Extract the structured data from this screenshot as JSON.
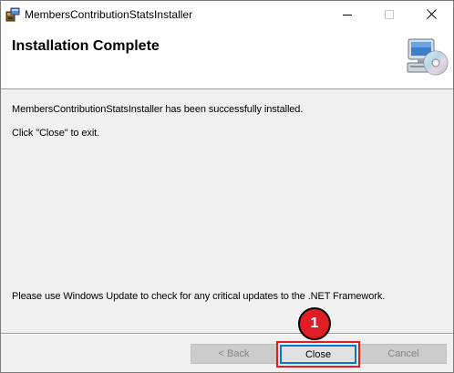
{
  "window": {
    "title": "MembersContributionStatsInstaller",
    "app_icon": "installer-package-icon",
    "controls": {
      "minimize_icon": "minimize-icon",
      "maximize_icon": "maximize-icon",
      "close_icon": "close-icon"
    }
  },
  "banner": {
    "title": "Installation Complete",
    "icon": "computer-cd-icon"
  },
  "messages": {
    "success": "MembersContributionStatsInstaller has been successfully installed.",
    "instruction": "Click \"Close\" to exit.",
    "update_notice": "Please use Windows Update to check for any critical updates to the .NET Framework."
  },
  "buttons": {
    "back_label": "< Back",
    "close_label": "Close",
    "cancel_label": "Cancel"
  },
  "annotation": {
    "step_number": "1",
    "highlight_color": "#e01c24"
  },
  "colors": {
    "accent": "#0078d7",
    "dialog_bg": "#f0f0f0",
    "disabled_text": "#838383"
  }
}
